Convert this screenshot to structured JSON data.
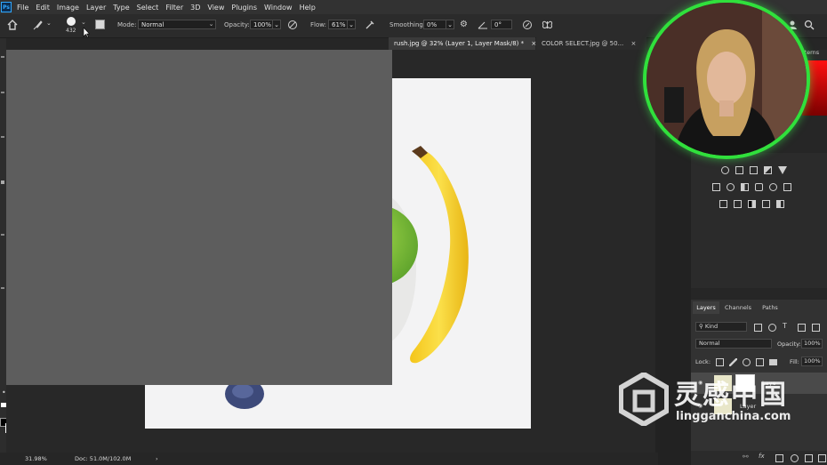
{
  "menubar": {
    "app_icon": "Ps",
    "items": [
      "File",
      "Edit",
      "Image",
      "Layer",
      "Type",
      "Select",
      "Filter",
      "3D",
      "View",
      "Plugins",
      "Window",
      "Help"
    ]
  },
  "options": {
    "brush_size": "432",
    "mode_label": "Mode:",
    "mode_value": "Normal",
    "opacity_label": "Opacity:",
    "opacity_value": "100%",
    "flow_label": "Flow:",
    "flow_value": "61%",
    "smoothing_label": "Smoothing:",
    "smoothing_value": "0%",
    "angle_value": "0°"
  },
  "tabs": [
    {
      "label": "rush.jpg @ 32% (Layer 1, Layer Mask/8) *",
      "close": "×"
    },
    {
      "label": "COLOR SELECT.jpg @ 50...",
      "close": "×"
    }
  ],
  "right_panel": {
    "top_partial": "tterns",
    "panel_tabs": [
      "Layers",
      "Channels",
      "Paths"
    ],
    "kind_label": "Kind",
    "blend_value": "Normal",
    "opacity_label": "Opacity:",
    "opacity_value": "100%",
    "lock_label": "Lock:",
    "fill_label": "Fill:",
    "fill_value": "100%",
    "layer_names": [
      "Laye",
      "Layer"
    ]
  },
  "status": {
    "zoom": "31.98%",
    "doc": "Doc: 51.0M/102.0M",
    "arrow": "›"
  },
  "watermark": {
    "cn": "灵感中国",
    "url": "lingganchina.com"
  },
  "colors": {
    "accent_green": "#30e03c",
    "banana": "#f5d11f",
    "lime": "#7cc23a"
  }
}
